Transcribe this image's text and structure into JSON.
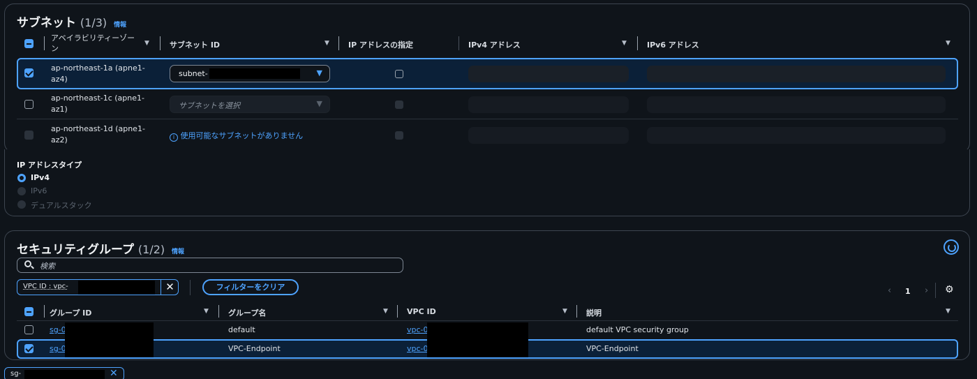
{
  "subnet": {
    "title": "サブネット",
    "count": "(1/3)",
    "info": "情報",
    "columns": [
      "アベイラビリティーゾーン",
      "サブネット ID",
      "IP アドレスの指定",
      "IPv4 アドレス",
      "IPv6 アドレス"
    ],
    "rows": [
      {
        "az_line1": "ap-northeast-1a (apne1-",
        "az_line2": "az4)",
        "subnet_value": "subnet-",
        "selected": true
      },
      {
        "az_line1": "ap-northeast-1c (apne1-",
        "az_line2": "az1)",
        "subnet_placeholder": "サブネットを選択",
        "selected": false
      },
      {
        "az_line1": "ap-northeast-1d (apne1-",
        "az_line2": "az2)",
        "no_subnet_text": "使用可能なサブネットがありません",
        "selected": false
      }
    ]
  },
  "ip_type": {
    "label": "IP アドレスタイプ",
    "options": [
      "IPv4",
      "IPv6",
      "デュアルスタック"
    ],
    "selected": "IPv4"
  },
  "security_group": {
    "title": "セキュリティグループ",
    "count": "(1/2)",
    "info": "情報",
    "search_placeholder": "検索",
    "filter_token": "VPC ID : vpc-",
    "clear_filter": "フィルターをクリア",
    "page": "1",
    "columns": [
      "グループ ID",
      "グループ名",
      "VPC ID",
      "説明"
    ],
    "rows": [
      {
        "group_id": "sg-0",
        "group_name": "default",
        "vpc_id": "vpc-0",
        "description": "default VPC security group",
        "selected": false
      },
      {
        "group_id": "sg-0",
        "group_name": "VPC-Endpoint",
        "vpc_id": "vpc-0",
        "description": "VPC-Endpoint",
        "selected": true
      }
    ]
  },
  "selected_token": {
    "label": "sg-"
  },
  "colors": {
    "accent": "#4ea3ff",
    "background": "#0f141a",
    "border": "#3d4550"
  }
}
